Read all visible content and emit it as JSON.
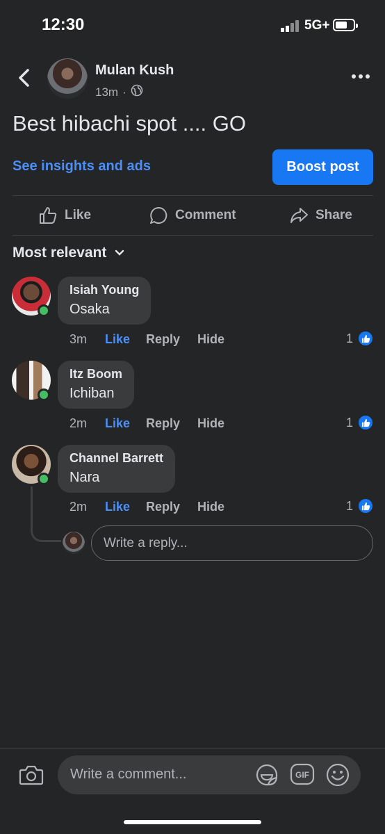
{
  "status_bar": {
    "time": "12:30",
    "network": "5G+"
  },
  "post": {
    "author": "Mulan Kush",
    "time_ago": "13m",
    "separator": "·",
    "text": "Best hibachi spot .... GO",
    "insights_link": "See insights and ads",
    "boost_button": "Boost post"
  },
  "actions": {
    "like": "Like",
    "comment": "Comment",
    "share": "Share"
  },
  "sort": {
    "label": "Most relevant"
  },
  "comments": [
    {
      "name": "Isiah Young",
      "text": "Osaka",
      "time": "3m",
      "like": "Like",
      "reply": "Reply",
      "hide": "Hide",
      "reactions": "1"
    },
    {
      "name": "Itz Boom",
      "text": "Ichiban",
      "time": "2m",
      "like": "Like",
      "reply": "Reply",
      "hide": "Hide",
      "reactions": "1"
    },
    {
      "name": "Channel Barrett",
      "text": "Nara",
      "time": "2m",
      "like": "Like",
      "reply": "Reply",
      "hide": "Hide",
      "reactions": "1"
    }
  ],
  "reply_box": {
    "placeholder": "Write a reply..."
  },
  "composer": {
    "placeholder": "Write a comment...",
    "gif_label": "GIF"
  },
  "colors": {
    "background": "#242526",
    "accent": "#1877f2",
    "link": "#4b8ef5",
    "online": "#45bd62"
  }
}
